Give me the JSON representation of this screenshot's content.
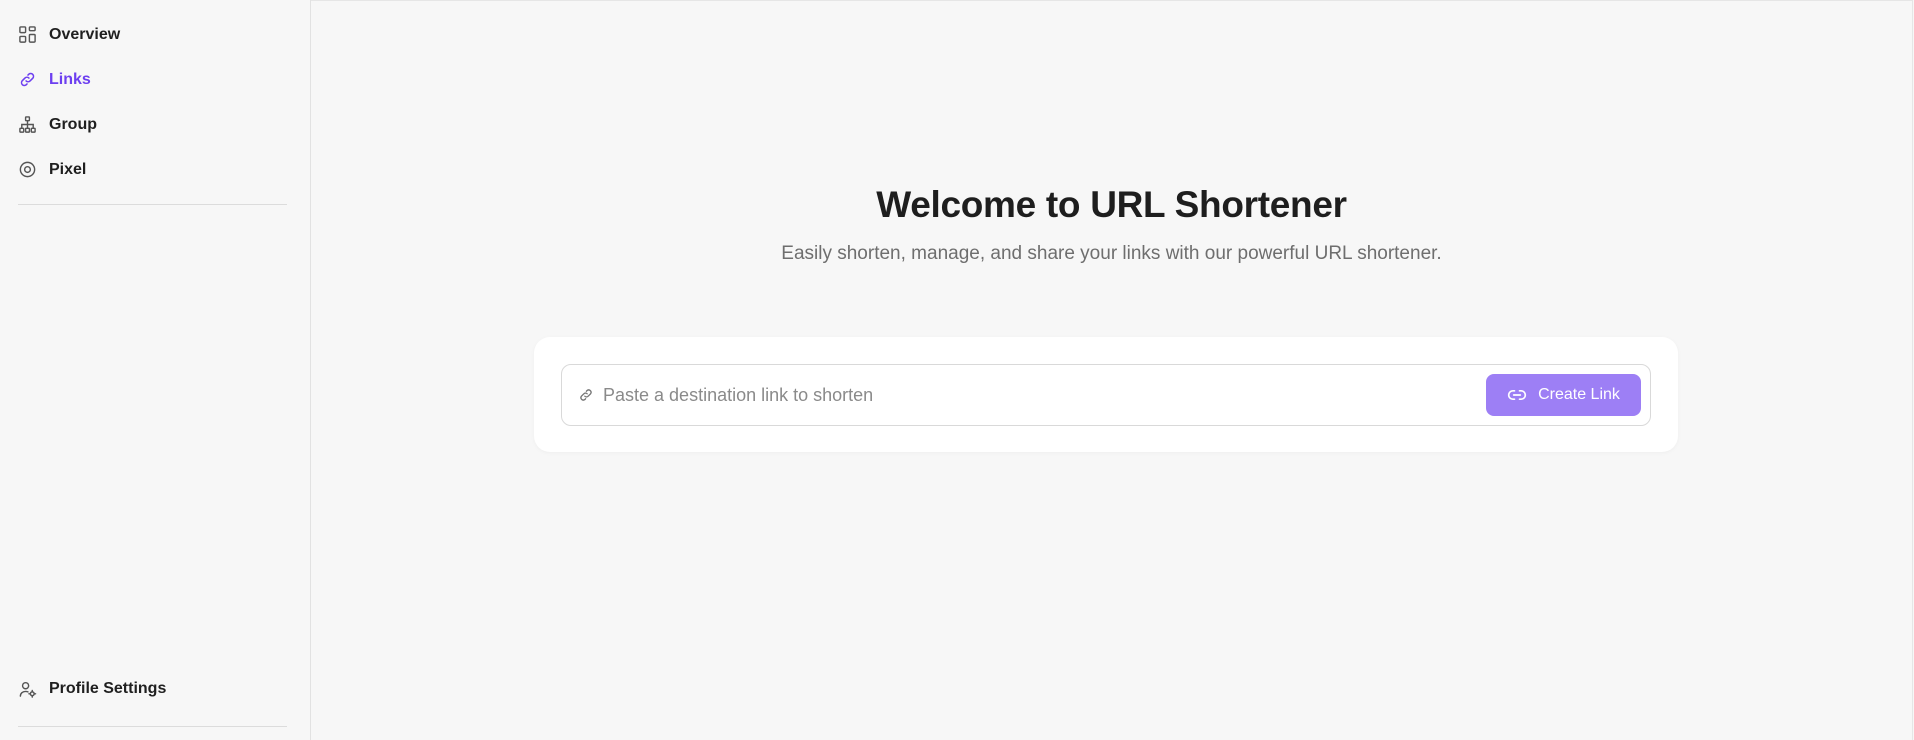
{
  "sidebar": {
    "items": [
      {
        "label": "Overview",
        "icon": "grid-icon",
        "active": false
      },
      {
        "label": "Links",
        "icon": "link-icon",
        "active": true
      },
      {
        "label": "Group",
        "icon": "sitemap-icon",
        "active": false
      },
      {
        "label": "Pixel",
        "icon": "target-icon",
        "active": false
      }
    ],
    "bottom": {
      "label": "Profile Settings",
      "icon": "user-settings-icon"
    }
  },
  "main": {
    "title": "Welcome to URL Shortener",
    "subtitle": "Easily shorten, manage, and share your links with our powerful URL shortener.",
    "input": {
      "placeholder": "Paste a destination link to shorten",
      "value": ""
    },
    "create_button": "Create Link"
  },
  "colors": {
    "accent": "#6d3ff0",
    "button": "#9d7ff5",
    "background": "#f7f7f7"
  }
}
